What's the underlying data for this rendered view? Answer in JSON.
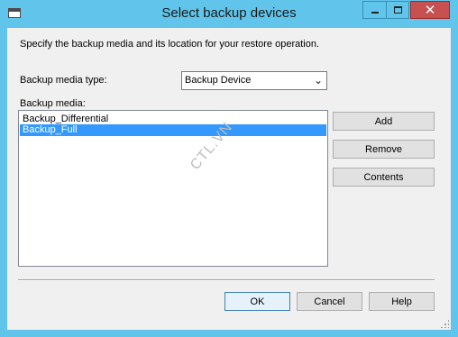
{
  "window": {
    "title": "Select backup devices"
  },
  "dialog": {
    "instruction": "Specify the backup media and its location for your restore operation.",
    "media_type_label": "Backup media type:",
    "media_type_value": "Backup Device",
    "media_label": "Backup media:",
    "media_items": [
      {
        "label": "Backup_Differential",
        "selected": false
      },
      {
        "label": "Backup_Full",
        "selected": true
      }
    ],
    "watermark": "CTL.VN"
  },
  "buttons": {
    "add": "Add",
    "remove": "Remove",
    "contents": "Contents",
    "ok": "OK",
    "cancel": "Cancel",
    "help": "Help"
  },
  "colors": {
    "titlebar": "#61c4ea",
    "close_button": "#c75050",
    "selection": "#3399ff"
  },
  "icons": {
    "system_menu": "window-icon",
    "minimize": "minimize-icon",
    "maximize": "maximize-icon",
    "close": "close-icon",
    "dropdown": "chevron-down-icon"
  }
}
